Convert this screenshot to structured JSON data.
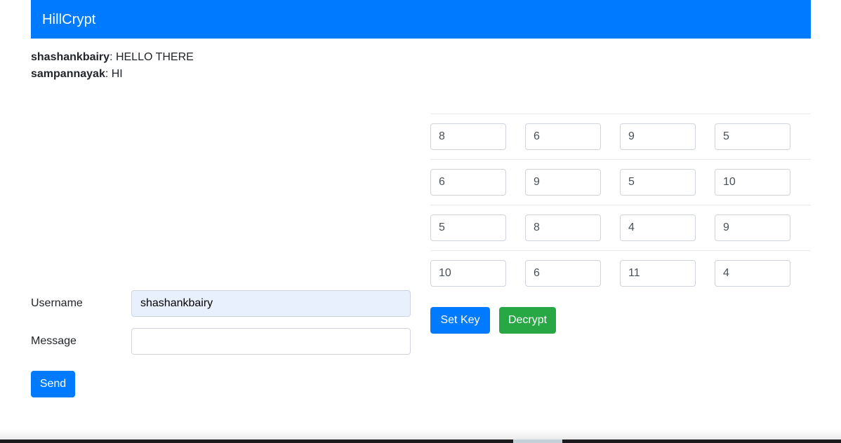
{
  "navbar": {
    "brand": "HillCrypt",
    "background_color": "#007bff",
    "text_color": "#ffffff"
  },
  "chat": {
    "messages": [
      {
        "user": "shashankbairy",
        "separator": ": ",
        "text": "HELLO THERE"
      },
      {
        "user": "sampannayak",
        "separator": ": ",
        "text": "HI"
      }
    ]
  },
  "form": {
    "username": {
      "label": "Username",
      "value": "shashankbairy",
      "placeholder": "",
      "autofilled": true,
      "autofill_color": "#e8f0fe"
    },
    "message": {
      "label": "Message",
      "value": "",
      "placeholder": ""
    },
    "send_button": {
      "label": "Send",
      "color": "#007bff"
    }
  },
  "key_matrix": {
    "rows": [
      [
        "8",
        "6",
        "9",
        "5"
      ],
      [
        "6",
        "9",
        "5",
        "10"
      ],
      [
        "5",
        "8",
        "4",
        "9"
      ],
      [
        "10",
        "6",
        "11",
        "4"
      ]
    ],
    "actions": {
      "set_key": {
        "label": "Set Key",
        "color": "#007bff"
      },
      "decrypt": {
        "label": "Decrypt",
        "color": "#28a745"
      }
    }
  },
  "taskbar": {
    "background_color": "#1c1c1e",
    "active_item_color": "#c7d0d6"
  }
}
